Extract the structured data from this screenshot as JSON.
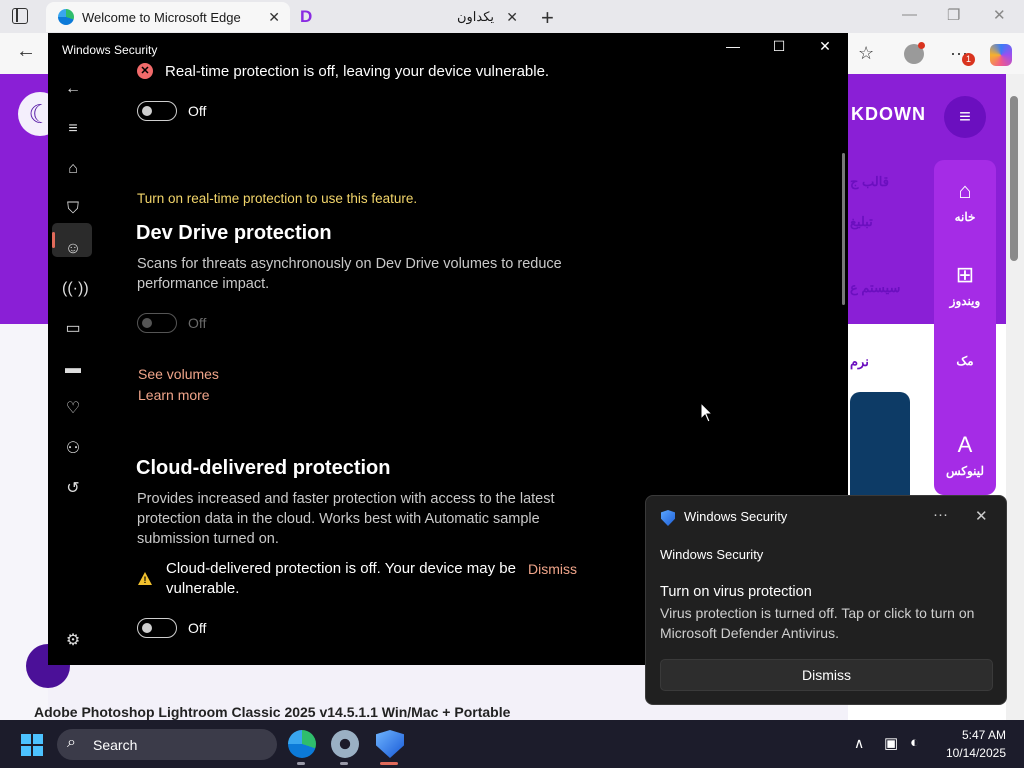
{
  "browser": {
    "tabs": [
      {
        "title": "Welcome to Microsoft Edge",
        "active": true
      },
      {
        "title": "یکداون",
        "active": false
      }
    ],
    "new_tab": "+",
    "notification_count": "1"
  },
  "website": {
    "logo_text": "KDOWN",
    "nav": [
      {
        "icon": "home-icon",
        "label": "خانه"
      },
      {
        "icon": "windows-icon",
        "label": "ویندوز"
      },
      {
        "icon": "apple-icon",
        "label": "مک"
      },
      {
        "icon": "linux-icon",
        "label": "لینوکس"
      }
    ],
    "menu_texts": [
      "قالب ج",
      "تبلیغ",
      "سیستم ع",
      "نرم"
    ],
    "bottom_title": "Adobe Photoshop Lightroom Classic 2025 v14.5.1.1 Win/Mac + Portable"
  },
  "ws": {
    "title": "Windows Security",
    "window_buttons": {
      "minimize": "—",
      "maximize": "☐",
      "close": "✕"
    },
    "realtime": {
      "status": "Real-time protection is off, leaving your device vulnerable.",
      "toggle_label": "Off"
    },
    "devdrive": {
      "hint": "Turn on real-time protection to use this feature.",
      "heading": "Dev Drive protection",
      "description": "Scans for threats asynchronously on Dev Drive volumes to reduce performance impact.",
      "toggle_label": "Off",
      "link_volumes": "See volumes",
      "link_learn": "Learn more"
    },
    "cloud": {
      "heading": "Cloud-delivered protection",
      "description": "Provides increased and faster protection with access to the latest protection data in the cloud. Works best with Automatic sample submission turned on.",
      "warning": "Cloud-delivered protection is off. Your device may be vulnerable.",
      "dismiss": "Dismiss",
      "toggle_label": "Off"
    }
  },
  "toast": {
    "app_name": "Windows Security",
    "more": "···",
    "close": "✕",
    "source": "Windows Security",
    "heading": "Turn on virus protection",
    "body": "Virus protection is turned off. Tap or click to turn on Microsoft Defender Antivirus.",
    "button": "Dismiss"
  },
  "taskbar": {
    "search_label": "Search",
    "time": "5:47 AM",
    "date": "10/14/2025"
  },
  "colors": {
    "link": "#f0a58a",
    "hint": "#f2d56a",
    "accent_purple": "#8a1fd6",
    "error": "#f16a6a",
    "warning": "#f2c12e"
  }
}
